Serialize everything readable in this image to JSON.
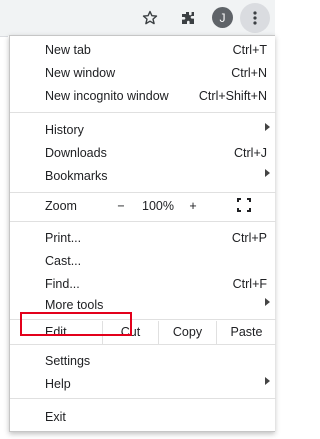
{
  "toolbar": {
    "icons": [
      "star-icon",
      "extensions-icon",
      "profile-avatar",
      "menu-icon"
    ],
    "avatar_letter": "J"
  },
  "menu": {
    "group1": [
      {
        "label": "New tab",
        "shortcut": "Ctrl+T"
      },
      {
        "label": "New window",
        "shortcut": "Ctrl+N"
      },
      {
        "label": "New incognito window",
        "shortcut": "Ctrl+Shift+N"
      }
    ],
    "group2": [
      {
        "label": "History",
        "submenu": true
      },
      {
        "label": "Downloads",
        "shortcut": "Ctrl+J"
      },
      {
        "label": "Bookmarks",
        "submenu": true
      }
    ],
    "zoom": {
      "label": "Zoom",
      "minus": "−",
      "value": "100%",
      "plus": "+"
    },
    "group3": [
      {
        "label": "Print...",
        "shortcut": "Ctrl+P"
      },
      {
        "label": "Cast..."
      },
      {
        "label": "Find...",
        "shortcut": "Ctrl+F"
      },
      {
        "label": "More tools",
        "submenu": true
      }
    ],
    "edit": {
      "label": "Edit",
      "cut": "Cut",
      "copy": "Copy",
      "paste": "Paste"
    },
    "group4": [
      {
        "label": "Settings"
      },
      {
        "label": "Help",
        "submenu": true
      }
    ],
    "exit": {
      "label": "Exit"
    }
  },
  "colors": {
    "highlight": "#e3001b",
    "toolbar_bg": "#f1f3f4"
  }
}
